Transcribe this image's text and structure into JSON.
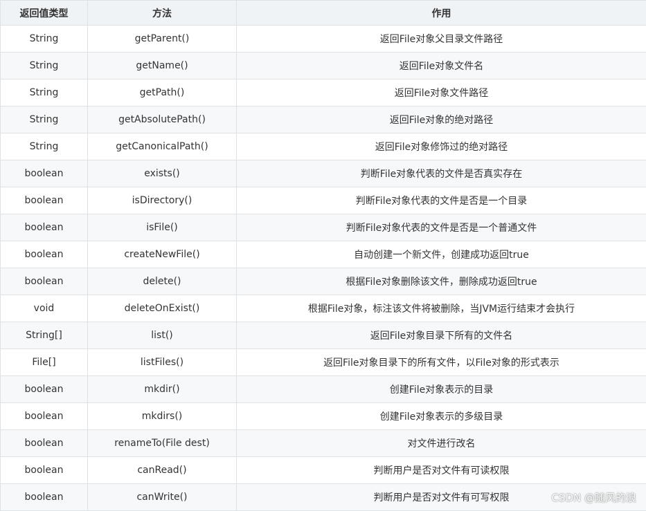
{
  "table": {
    "headers": [
      "返回值类型",
      "方法",
      "作用"
    ],
    "rows": [
      [
        "String",
        "getParent()",
        "返回File对象父目录文件路径"
      ],
      [
        "String",
        "getName()",
        "返回File对象文件名"
      ],
      [
        "String",
        "getPath()",
        "返回File对象文件路径"
      ],
      [
        "String",
        "getAbsolutePath()",
        "返回File对象的绝对路径"
      ],
      [
        "String",
        "getCanonicalPath()",
        "返回File对象修饰过的绝对路径"
      ],
      [
        "boolean",
        "exists()",
        "判断File对象代表的文件是否真实存在"
      ],
      [
        "boolean",
        "isDirectory()",
        "判断File对象代表的文件是否是一个目录"
      ],
      [
        "boolean",
        "isFile()",
        "判断File对象代表的文件是否是一个普通文件"
      ],
      [
        "boolean",
        "createNewFile()",
        "自动创建一个新文件，创建成功返回true"
      ],
      [
        "boolean",
        "delete()",
        "根据File对象删除该文件，删除成功返回true"
      ],
      [
        "void",
        "deleteOnExist()",
        "根据File对象，标注该文件将被删除，当JVM运行结束才会执行"
      ],
      [
        "String[]",
        "list()",
        "返回File对象目录下所有的文件名"
      ],
      [
        "File[]",
        "listFiles()",
        "返回File对象目录下的所有文件，以File对象的形式表示"
      ],
      [
        "boolean",
        "mkdir()",
        "创建File对象表示的目录"
      ],
      [
        "boolean",
        "mkdirs()",
        "创建File对象表示的多级目录"
      ],
      [
        "boolean",
        "renameTo(File dest)",
        "对文件进行改名"
      ],
      [
        "boolean",
        "canRead()",
        "判断用户是否对文件有可读权限"
      ],
      [
        "boolean",
        "canWrite()",
        "判断用户是否对文件有可写权限"
      ]
    ]
  },
  "watermark": "CSDN @随风的浪"
}
